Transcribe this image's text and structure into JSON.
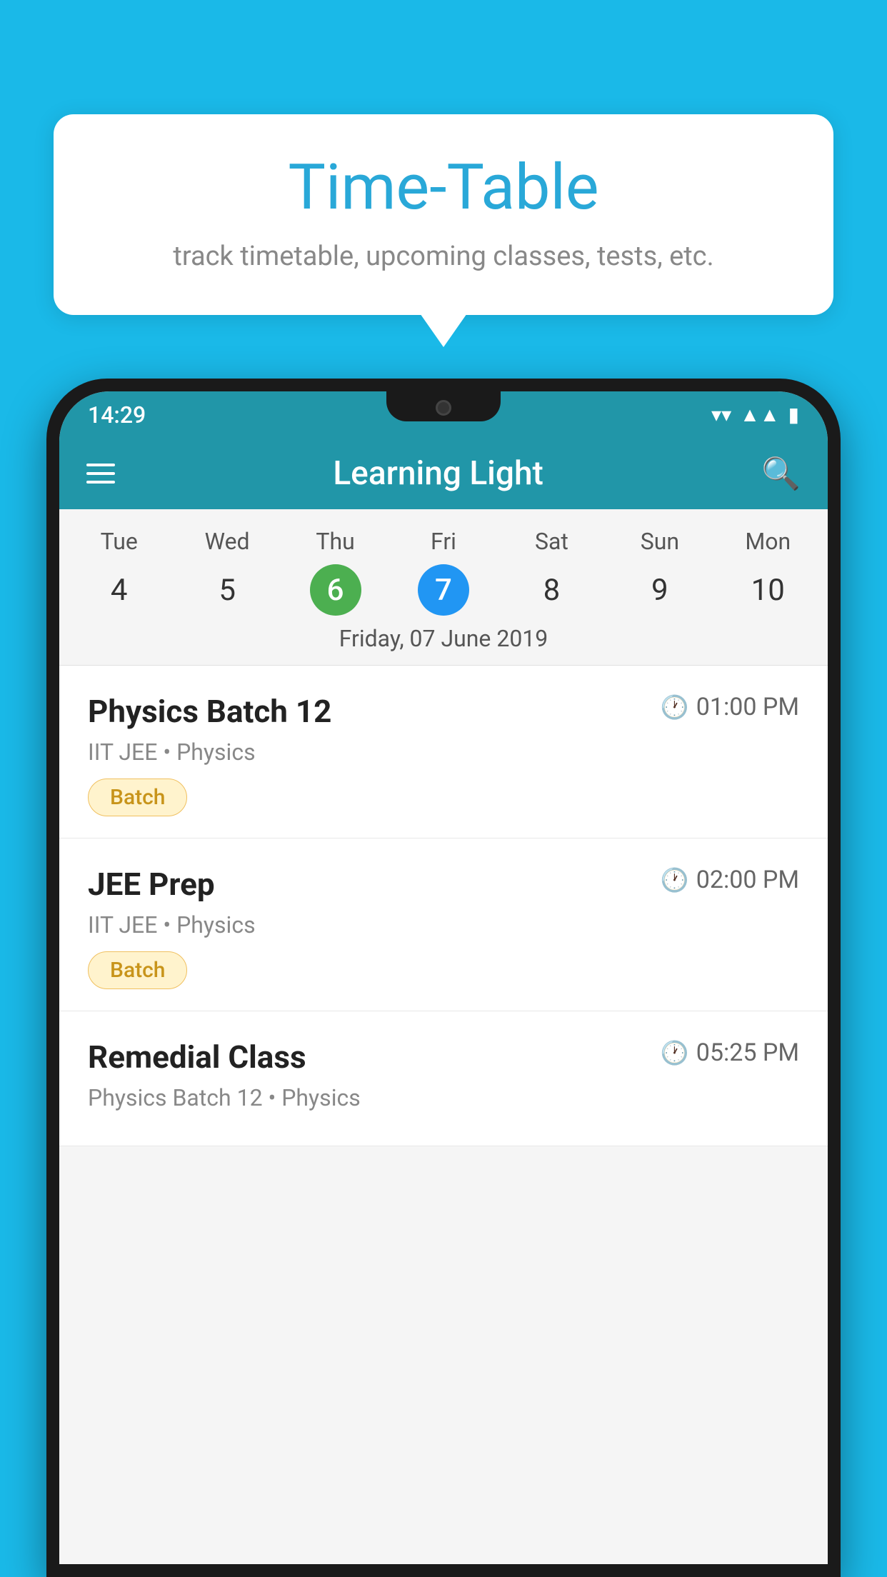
{
  "page": {
    "background_color": "#1ab9e8"
  },
  "tooltip": {
    "title": "Time-Table",
    "subtitle": "track timetable, upcoming classes, tests, etc."
  },
  "status_bar": {
    "time": "14:29"
  },
  "app_bar": {
    "title": "Learning Light"
  },
  "calendar": {
    "days": [
      {
        "label": "Tue",
        "num": "4"
      },
      {
        "label": "Wed",
        "num": "5"
      },
      {
        "label": "Thu",
        "num": "6",
        "state": "today"
      },
      {
        "label": "Fri",
        "num": "7",
        "state": "selected"
      },
      {
        "label": "Sat",
        "num": "8"
      },
      {
        "label": "Sun",
        "num": "9"
      },
      {
        "label": "Mon",
        "num": "10"
      }
    ],
    "selected_date_label": "Friday, 07 June 2019"
  },
  "classes": [
    {
      "name": "Physics Batch 12",
      "time": "01:00 PM",
      "meta": "IIT JEE • Physics",
      "tag": "Batch"
    },
    {
      "name": "JEE Prep",
      "time": "02:00 PM",
      "meta": "IIT JEE • Physics",
      "tag": "Batch"
    },
    {
      "name": "Remedial Class",
      "time": "05:25 PM",
      "meta": "Physics Batch 12 • Physics",
      "tag": ""
    }
  ]
}
